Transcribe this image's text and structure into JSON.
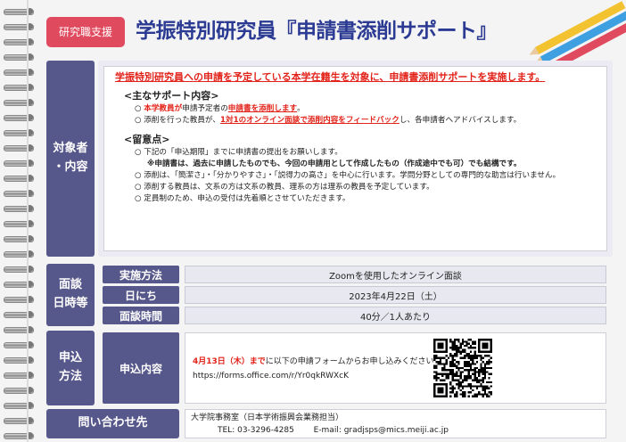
{
  "header": {
    "tag": "研究職支援",
    "title": "学振特別研究員『申請書添削サポート』"
  },
  "target": {
    "label_line1": "対象者",
    "label_line2": "・内容",
    "intro": "学振特別研究員への申請を予定している本学在籍生を対象に、申請書添削サポートを実施します。",
    "support_heading": "<主なサポート内容>",
    "support_items": [
      {
        "pre": "",
        "red1": "本学教員が",
        "mid": "申請予定者の",
        "red2": "申請書を添削します",
        "post": "。"
      },
      {
        "pre": "添削を行った教員が、",
        "red1": "1対1のオンライン面談で添削内容をフィードバック",
        "mid": "し、各申請者へアドバイスします。",
        "red2": "",
        "post": ""
      }
    ],
    "notes_heading": "<留意点>",
    "notes": [
      "下記の「申込期限」までに申請書の提出をお願いします。",
      "添削は、「簡潔さ」・「分かりやすさ」・「説得力の高さ」を中心に行います。学問分野としての専門的な助言は行いません。",
      "添削する教員は、文系の方は文系の教員、理系の方は理系の教員を予定しています。",
      "定員制のため、申込の受付は先着順とさせていただきます。"
    ],
    "bold_note": "※申請書は、過去に申請したものでも、今回の申請用として作成したもの（作成途中でも可）でも結構です。"
  },
  "interview": {
    "label_line1": "面談",
    "label_line2": "日時等",
    "rows": [
      {
        "label": "実施方法",
        "value": "Zoomを使用したオンライン面談"
      },
      {
        "label": "日にち",
        "value": "2023年4月22日（土）"
      },
      {
        "label": "面談時間",
        "value": "40分／1人あたり"
      }
    ]
  },
  "apply": {
    "label_line1": "申込",
    "label_line2": "方法",
    "sub_label": "申込内容",
    "deadline": "4月13日（木）まで",
    "text": "に以下の申請フォームからお申し込みください。",
    "url": "https://forms.office.com/r/Yr0qkRWXcK"
  },
  "contact": {
    "label": "問い合わせ先",
    "office": "大学院事務室（日本学術振興会業務担当）",
    "tel": "TEL: 03-3296-4285",
    "email": "E-mail: gradjsps@mics.meiji.ac.jp"
  },
  "colors": {
    "accent": "#56578a",
    "title": "#2b3a93",
    "tag": "#e04a5e",
    "red": "#e2231a"
  },
  "icons": [
    "spiral-binding",
    "pencils-decoration",
    "qr-code"
  ]
}
